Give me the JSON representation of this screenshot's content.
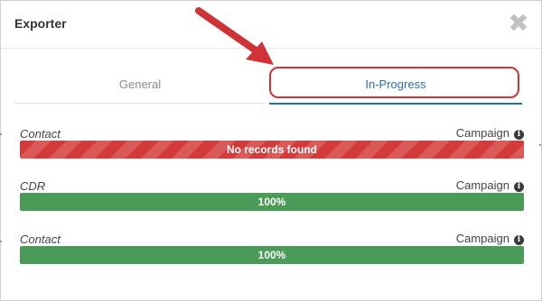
{
  "dialog": {
    "title": "Exporter",
    "close_icon": "close-icon",
    "close_symbol": "✖"
  },
  "tabs": [
    {
      "label": "General",
      "active": false
    },
    {
      "label": "In-Progress",
      "active": true
    }
  ],
  "annotation": {
    "arrow_color": "#cf3337",
    "highlight_color": "#cf3337"
  },
  "exports": [
    {
      "label": "Contact",
      "right_label": "Campaign",
      "status_text": "No records found",
      "status": "error",
      "progress": 1.0,
      "info_icon": "info-icon",
      "info_symbol": "i"
    },
    {
      "label": "CDR",
      "right_label": "Campaign",
      "status_text": "100%",
      "status": "success",
      "progress": 1.0,
      "info_icon": "info-icon",
      "info_symbol": "i"
    },
    {
      "label": "Contact",
      "right_label": "Campaign",
      "status_text": "100%",
      "status": "success",
      "progress": 1.0,
      "info_icon": "info-icon",
      "info_symbol": "i"
    }
  ],
  "colors": {
    "error": "#d33a3a",
    "success": "#4a9a58",
    "active_tab": "#2a6fb0",
    "inactive_tab": "#8a8a8a"
  }
}
